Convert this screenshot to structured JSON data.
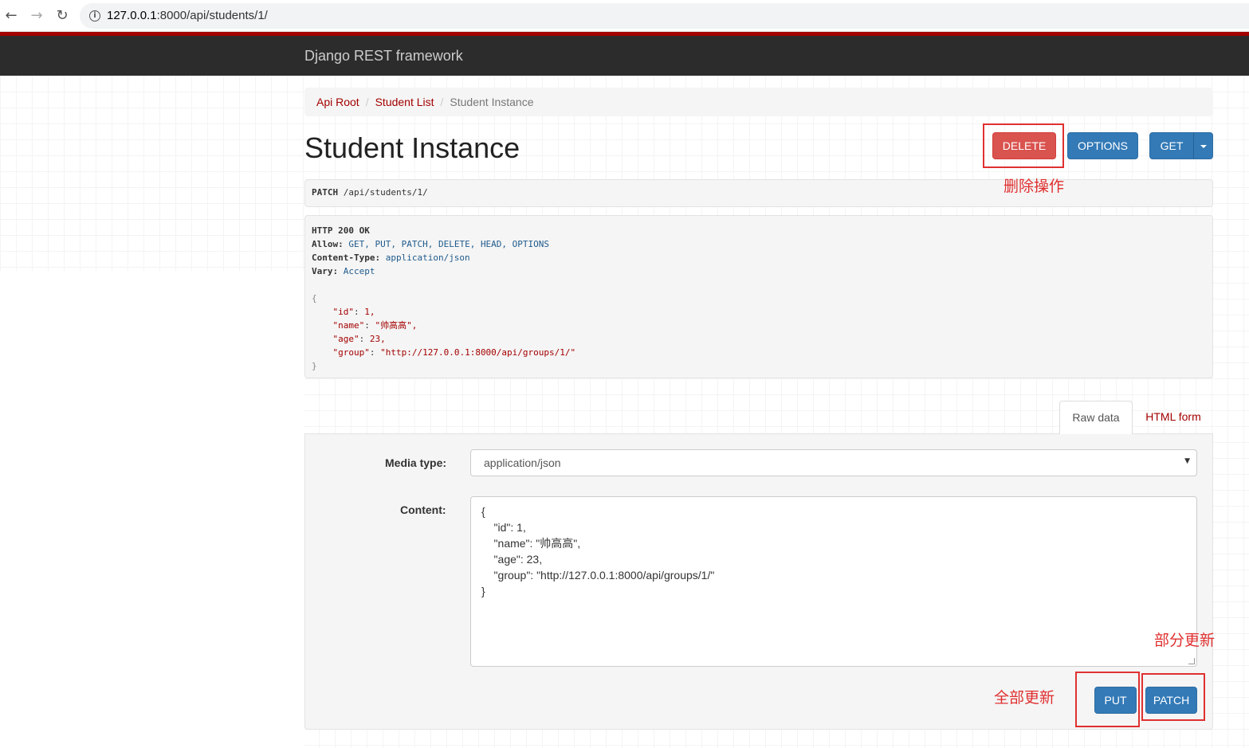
{
  "browser": {
    "url_host": "127.0.0.1",
    "url_path": ":8000/api/students/1/"
  },
  "navbar": {
    "brand": "Django REST framework"
  },
  "breadcrumb": {
    "items": [
      "Api Root",
      "Student List"
    ],
    "active": "Student Instance"
  },
  "page": {
    "title": "Student Instance"
  },
  "toolbar": {
    "delete_label": "DELETE",
    "options_label": "OPTIONS",
    "get_label": "GET"
  },
  "request": {
    "method": "PATCH",
    "path": "/api/students/1/"
  },
  "response": {
    "status": "HTTP 200 OK",
    "headers": [
      {
        "name": "Allow:",
        "value": "GET, PUT, PATCH, DELETE, HEAD, OPTIONS"
      },
      {
        "name": "Content-Type:",
        "value": "application/json"
      },
      {
        "name": "Vary:",
        "value": "Accept"
      }
    ],
    "body": {
      "open": "{",
      "fields": [
        {
          "key": "\"id\"",
          "value": "1,"
        },
        {
          "key": "\"name\"",
          "value": "\"帅高高\","
        },
        {
          "key": "\"age\"",
          "value": "23,"
        },
        {
          "key": "\"group\"",
          "value": "\"http://127.0.0.1:8000/api/groups/1/\""
        }
      ],
      "close": "}"
    }
  },
  "tabs": {
    "raw": "Raw data",
    "html": "HTML form"
  },
  "form": {
    "media_type_label": "Media type:",
    "media_type_value": "application/json",
    "content_label": "Content:",
    "content_lines": [
      "{",
      "    \"id\": 1,",
      "    \"name\": \"帅高高\",",
      "    \"age\": 23,",
      "    \"group\": \"http://127.0.0.1:8000/api/groups/1/\"",
      "}"
    ],
    "put_label": "PUT",
    "patch_label": "PATCH"
  },
  "annotations": {
    "delete_note": "删除操作",
    "patch_note": "部分更新",
    "put_note": "全部更新"
  },
  "colors": {
    "brand_red": "#a30000",
    "danger": "#d9534f",
    "primary": "#337ab7",
    "annotation": "#e03030"
  }
}
